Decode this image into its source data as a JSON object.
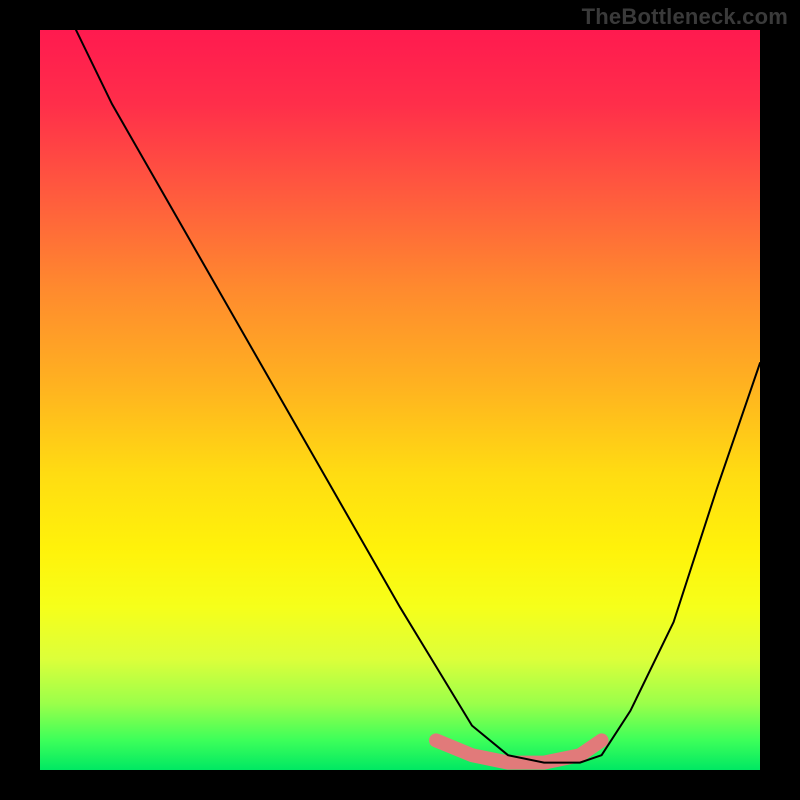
{
  "watermark": "TheBottleneck.com",
  "chart_data": {
    "type": "line",
    "title": "",
    "xlabel": "",
    "ylabel": "",
    "xlim": [
      0,
      100
    ],
    "ylim": [
      0,
      100
    ],
    "grid": false,
    "legend": false,
    "background_gradient": {
      "top": "#ff1a4f",
      "middle": "#ffe600",
      "bottom": "#00e863"
    },
    "series": [
      {
        "name": "bottleneck-curve",
        "color": "#000000",
        "x": [
          5,
          10,
          20,
          30,
          40,
          50,
          55,
          60,
          65,
          70,
          75,
          78,
          82,
          88,
          94,
          100
        ],
        "values": [
          100,
          90,
          73,
          56,
          39,
          22,
          14,
          6,
          2,
          1,
          1,
          2,
          8,
          20,
          38,
          55
        ]
      }
    ],
    "highlight_region": {
      "name": "optimal-range",
      "color": "#e17a7a",
      "x": [
        55,
        60,
        65,
        70,
        75,
        78
      ],
      "values": [
        4,
        2,
        1,
        1,
        2,
        4
      ]
    }
  }
}
